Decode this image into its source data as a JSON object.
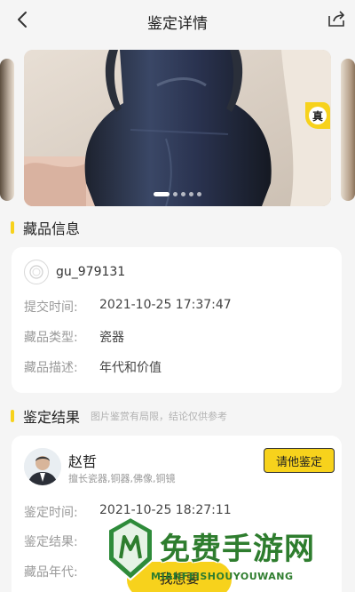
{
  "header": {
    "title": "鉴定详情"
  },
  "badge": {
    "label": "真"
  },
  "carousel": {
    "count": 5,
    "active": 0
  },
  "collection": {
    "section_title": "藏品信息",
    "username": "gu_979131",
    "fields": [
      {
        "label": "提交时间:",
        "value": "2021-10-25 17:37:47"
      },
      {
        "label": "藏品类型:",
        "value": "瓷器"
      },
      {
        "label": "藏品描述:",
        "value": "年代和价值"
      }
    ]
  },
  "result": {
    "section_title": "鉴定结果",
    "hint": "图片鉴赏有局限，结论仅供参考",
    "expert_name": "赵哲",
    "expert_tags": "擅长瓷器,铜器,佛像,铜镜",
    "other_button": "请他鉴定",
    "fields": [
      {
        "label": "鉴定时间:",
        "value": "2021-10-25 18:27:11"
      },
      {
        "label": "鉴定结果:",
        "value": ""
      },
      {
        "label": "藏品年代:",
        "value": ""
      }
    ]
  },
  "bottom": {
    "want_button": "我想要"
  },
  "watermark": {
    "text": "免费手游网",
    "sub": "MIANFEISHOUYOUWANG"
  },
  "colors": {
    "accent": "#f7d21c",
    "background": "#f5f5f5",
    "watermark": "#2e7d2e"
  }
}
